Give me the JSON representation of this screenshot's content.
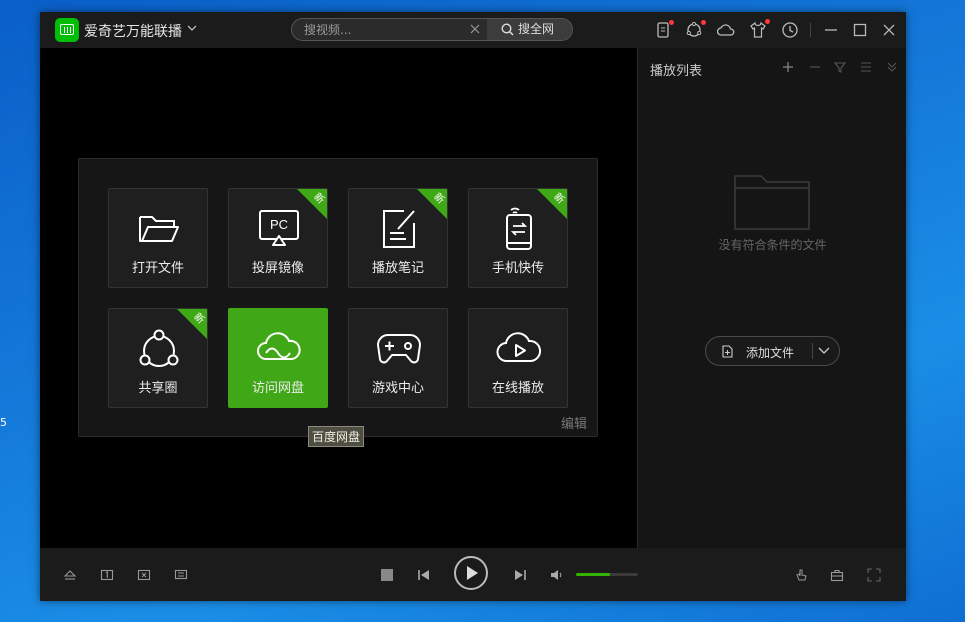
{
  "app": {
    "title": "爱奇艺万能联播"
  },
  "search": {
    "placeholder": "搜视频...",
    "button_label": "搜全网"
  },
  "toolbar_icons": [
    "phone-transfer-icon",
    "share-circle-icon",
    "cloud-icon",
    "skin-shirt-icon",
    "history-clock-icon",
    "minimize-icon",
    "maximize-icon",
    "close-icon"
  ],
  "tiles": [
    {
      "label": "打开文件",
      "icon": "folder-open-icon",
      "new": false
    },
    {
      "label": "投屏镜像",
      "icon": "pc-cast-icon",
      "new": true
    },
    {
      "label": "播放笔记",
      "icon": "note-edit-icon",
      "new": true
    },
    {
      "label": "手机快传",
      "icon": "phone-transfer-icon",
      "new": true
    },
    {
      "label": "共享圈",
      "icon": "share-circle-icon",
      "new": true
    },
    {
      "label": "访问网盘",
      "icon": "cloud-drive-icon",
      "new": false,
      "active": true
    },
    {
      "label": "游戏中心",
      "icon": "gamepad-icon",
      "new": false
    },
    {
      "label": "在线播放",
      "icon": "cloud-play-icon",
      "new": false
    }
  ],
  "badge_text": "新",
  "panel": {
    "edit_label": "编辑"
  },
  "tooltip": {
    "text": "百度网盘"
  },
  "playlist": {
    "title": "播放列表",
    "empty_text": "没有符合条件的文件",
    "add_file_label": "添加文件"
  },
  "player": {
    "volume": 0.55
  },
  "desktop": {
    "edge_text": "5"
  },
  "colors": {
    "accent": "#40a716",
    "badge": "#3fa816",
    "window_bg": "#000000",
    "titlebar_bg": "#1b1b1b"
  }
}
